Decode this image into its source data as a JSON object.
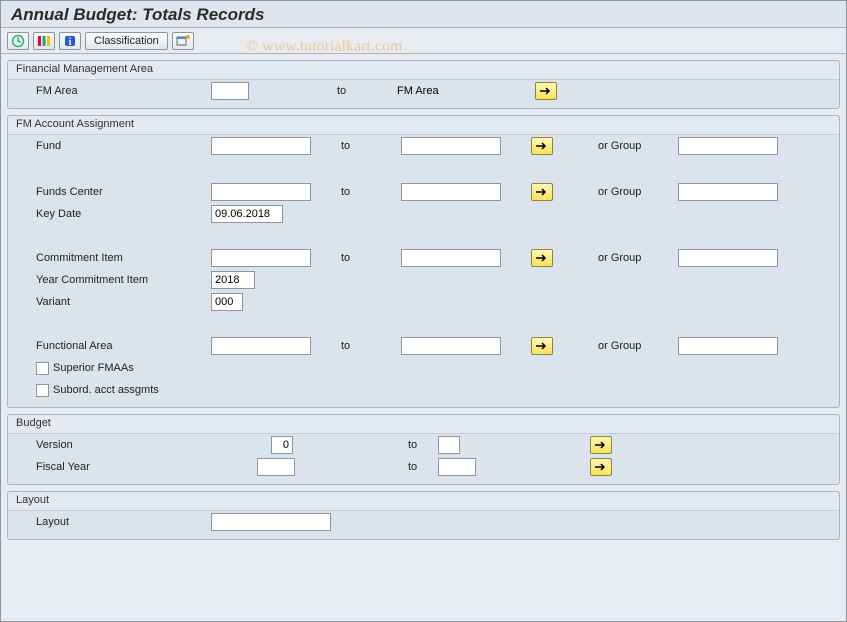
{
  "title": "Annual Budget: Totals Records",
  "watermark": "©  www.tutorialkart.com",
  "toolbar": {
    "classification_label": "Classification"
  },
  "groups": {
    "fm_area": {
      "title": "Financial Management Area",
      "label": "FM Area",
      "from": "",
      "to_label": "to",
      "to": "FM Area"
    },
    "assignment": {
      "title": "FM Account Assignment",
      "fund_label": "Fund",
      "fund_from": "",
      "fund_to": "",
      "fund_group": "",
      "funds_center_label": "Funds Center",
      "funds_center_from": "",
      "funds_center_to": "",
      "funds_center_group": "",
      "key_date_label": "Key Date",
      "key_date": "09.06.2018",
      "commitment_item_label": "Commitment Item",
      "commitment_item_from": "",
      "commitment_item_to": "",
      "commitment_item_group": "",
      "year_ci_label": "Year Commitment Item",
      "year_ci": "2018",
      "variant_label": "Variant",
      "variant": "000",
      "func_area_label": "Functional Area",
      "func_area_from": "",
      "func_area_to": "",
      "func_area_group": "",
      "superior_label": "Superior FMAAs",
      "subord_label": "Subord. acct assgmts",
      "to_label": "to",
      "or_group_label": "or Group"
    },
    "budget": {
      "title": "Budget",
      "version_label": "Version",
      "version_from": "0",
      "version_to": "",
      "fiscal_year_label": "Fiscal Year",
      "fiscal_year_from": "",
      "fiscal_year_to": "",
      "to_label": "to"
    },
    "layout": {
      "title": "Layout",
      "label": "Layout",
      "value": ""
    }
  }
}
